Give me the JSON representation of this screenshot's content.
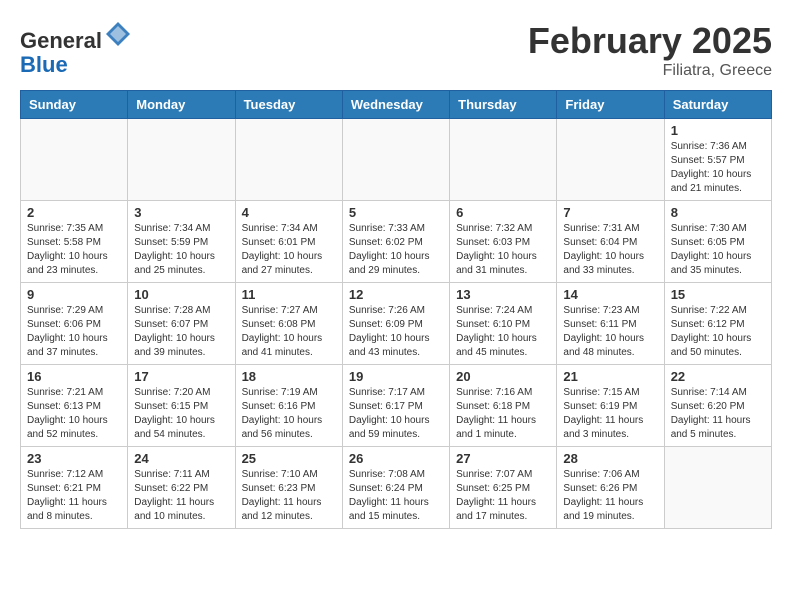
{
  "header": {
    "logo_line1": "General",
    "logo_line2": "Blue",
    "month_title": "February 2025",
    "location": "Filiatra, Greece"
  },
  "weekdays": [
    "Sunday",
    "Monday",
    "Tuesday",
    "Wednesday",
    "Thursday",
    "Friday",
    "Saturday"
  ],
  "weeks": [
    [
      {
        "day": "",
        "info": ""
      },
      {
        "day": "",
        "info": ""
      },
      {
        "day": "",
        "info": ""
      },
      {
        "day": "",
        "info": ""
      },
      {
        "day": "",
        "info": ""
      },
      {
        "day": "",
        "info": ""
      },
      {
        "day": "1",
        "info": "Sunrise: 7:36 AM\nSunset: 5:57 PM\nDaylight: 10 hours and 21 minutes."
      }
    ],
    [
      {
        "day": "2",
        "info": "Sunrise: 7:35 AM\nSunset: 5:58 PM\nDaylight: 10 hours and 23 minutes."
      },
      {
        "day": "3",
        "info": "Sunrise: 7:34 AM\nSunset: 5:59 PM\nDaylight: 10 hours and 25 minutes."
      },
      {
        "day": "4",
        "info": "Sunrise: 7:34 AM\nSunset: 6:01 PM\nDaylight: 10 hours and 27 minutes."
      },
      {
        "day": "5",
        "info": "Sunrise: 7:33 AM\nSunset: 6:02 PM\nDaylight: 10 hours and 29 minutes."
      },
      {
        "day": "6",
        "info": "Sunrise: 7:32 AM\nSunset: 6:03 PM\nDaylight: 10 hours and 31 minutes."
      },
      {
        "day": "7",
        "info": "Sunrise: 7:31 AM\nSunset: 6:04 PM\nDaylight: 10 hours and 33 minutes."
      },
      {
        "day": "8",
        "info": "Sunrise: 7:30 AM\nSunset: 6:05 PM\nDaylight: 10 hours and 35 minutes."
      }
    ],
    [
      {
        "day": "9",
        "info": "Sunrise: 7:29 AM\nSunset: 6:06 PM\nDaylight: 10 hours and 37 minutes."
      },
      {
        "day": "10",
        "info": "Sunrise: 7:28 AM\nSunset: 6:07 PM\nDaylight: 10 hours and 39 minutes."
      },
      {
        "day": "11",
        "info": "Sunrise: 7:27 AM\nSunset: 6:08 PM\nDaylight: 10 hours and 41 minutes."
      },
      {
        "day": "12",
        "info": "Sunrise: 7:26 AM\nSunset: 6:09 PM\nDaylight: 10 hours and 43 minutes."
      },
      {
        "day": "13",
        "info": "Sunrise: 7:24 AM\nSunset: 6:10 PM\nDaylight: 10 hours and 45 minutes."
      },
      {
        "day": "14",
        "info": "Sunrise: 7:23 AM\nSunset: 6:11 PM\nDaylight: 10 hours and 48 minutes."
      },
      {
        "day": "15",
        "info": "Sunrise: 7:22 AM\nSunset: 6:12 PM\nDaylight: 10 hours and 50 minutes."
      }
    ],
    [
      {
        "day": "16",
        "info": "Sunrise: 7:21 AM\nSunset: 6:13 PM\nDaylight: 10 hours and 52 minutes."
      },
      {
        "day": "17",
        "info": "Sunrise: 7:20 AM\nSunset: 6:15 PM\nDaylight: 10 hours and 54 minutes."
      },
      {
        "day": "18",
        "info": "Sunrise: 7:19 AM\nSunset: 6:16 PM\nDaylight: 10 hours and 56 minutes."
      },
      {
        "day": "19",
        "info": "Sunrise: 7:17 AM\nSunset: 6:17 PM\nDaylight: 10 hours and 59 minutes."
      },
      {
        "day": "20",
        "info": "Sunrise: 7:16 AM\nSunset: 6:18 PM\nDaylight: 11 hours and 1 minute."
      },
      {
        "day": "21",
        "info": "Sunrise: 7:15 AM\nSunset: 6:19 PM\nDaylight: 11 hours and 3 minutes."
      },
      {
        "day": "22",
        "info": "Sunrise: 7:14 AM\nSunset: 6:20 PM\nDaylight: 11 hours and 5 minutes."
      }
    ],
    [
      {
        "day": "23",
        "info": "Sunrise: 7:12 AM\nSunset: 6:21 PM\nDaylight: 11 hours and 8 minutes."
      },
      {
        "day": "24",
        "info": "Sunrise: 7:11 AM\nSunset: 6:22 PM\nDaylight: 11 hours and 10 minutes."
      },
      {
        "day": "25",
        "info": "Sunrise: 7:10 AM\nSunset: 6:23 PM\nDaylight: 11 hours and 12 minutes."
      },
      {
        "day": "26",
        "info": "Sunrise: 7:08 AM\nSunset: 6:24 PM\nDaylight: 11 hours and 15 minutes."
      },
      {
        "day": "27",
        "info": "Sunrise: 7:07 AM\nSunset: 6:25 PM\nDaylight: 11 hours and 17 minutes."
      },
      {
        "day": "28",
        "info": "Sunrise: 7:06 AM\nSunset: 6:26 PM\nDaylight: 11 hours and 19 minutes."
      },
      {
        "day": "",
        "info": ""
      }
    ]
  ]
}
